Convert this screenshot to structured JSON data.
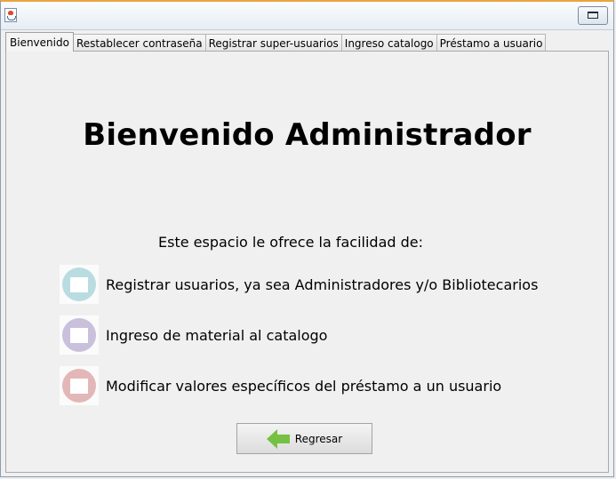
{
  "tabs": [
    {
      "label": "Bienvenido",
      "active": true
    },
    {
      "label": "Restablecer contraseña",
      "active": false
    },
    {
      "label": "Registrar super-usuarios",
      "active": false
    },
    {
      "label": "Ingreso catalogo",
      "active": false
    },
    {
      "label": "Préstamo a usuario",
      "active": false
    }
  ],
  "main": {
    "heading": "Bienvenido Administrador",
    "intro": "Este espacio le ofrece la facilidad de:",
    "features": [
      {
        "label": "Registrar usuarios, ya sea Administradores y/o Bibliotecarios",
        "icon": "book-icon",
        "color": "#b9dce1"
      },
      {
        "label": "Ingreso de material al catalogo",
        "icon": "book-icon",
        "color": "#c9c0dc"
      },
      {
        "label": "Modificar valores específicos del préstamo a un usuario",
        "icon": "book-icon",
        "color": "#e3b7b7"
      }
    ],
    "back_button": {
      "label": "Regresar",
      "icon": "back-arrow-icon",
      "color": "#76c043"
    }
  }
}
